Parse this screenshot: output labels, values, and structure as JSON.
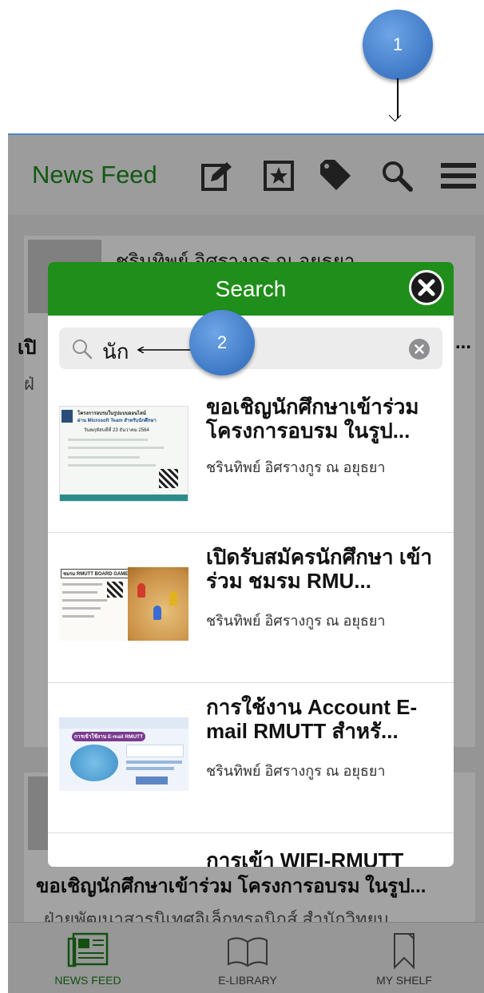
{
  "annotations": {
    "step1": "1",
    "step2": "2"
  },
  "header": {
    "title": "News Feed"
  },
  "feed": [
    {
      "author": "ชรินทิพย์ อิศรางกูร ณ อยุธยา",
      "title": "เปิ",
      "title_right": "...",
      "subtitle": "ฝ่"
    },
    {
      "title": "ขอเชิญนักศึกษาเข้าร่วม โครงการอบรม ในรูป...",
      "subtitle": "ฝ่ายพัฒนาสารนิเทศอิเล็กทรอนิกส์ สำนักวิทยบ"
    }
  ],
  "tabs": [
    {
      "label": "NEWS FEED",
      "icon": "newspaper-icon"
    },
    {
      "label": "E-LIBRARY",
      "icon": "open-book-icon"
    },
    {
      "label": "MY SHELF",
      "icon": "bookmark-icon"
    }
  ],
  "search_modal": {
    "title": "Search",
    "query": "นัก",
    "results": [
      {
        "title": "ขอเชิญนักศึกษาเข้าร่วม โครงการอบรม ในรูป...",
        "author": "ชรินทิพย์ อิศรางกูร ณ อยุธยา",
        "thumb": {
          "line1": "โครงการอบรมในรูปแบบออนไลน์",
          "line2": "ผ่าน Microsoft Team สำหรับนักศึกษา",
          "line3": "วันพฤหัสบดีที่ 23 ธันวาคม 2564"
        }
      },
      {
        "title": "เปิดรับสมัครนักศึกษา เข้าร่วม ชมรม RMU...",
        "author": "ชรินทิพย์ อิศรางกูร ณ อยุธยา",
        "thumb": {
          "line1": "ชมรม RMUTT BOARD GAME"
        }
      },
      {
        "title": "การใช้งาน Account E-mail RMUTT สำหรั...",
        "author": "ชรินทิพย์ อิศรางกูร ณ อยุธยา",
        "thumb": {
          "line1": "การเข้าใช้งาน E-mail RMUTT"
        }
      },
      {
        "title": "การเข้า WIFI-RMUTT",
        "author": ""
      }
    ]
  },
  "colors": {
    "brand_green": "#1f8e1a",
    "title_green": "#1d8a1d",
    "annotation_blue": "#3f79c6"
  }
}
